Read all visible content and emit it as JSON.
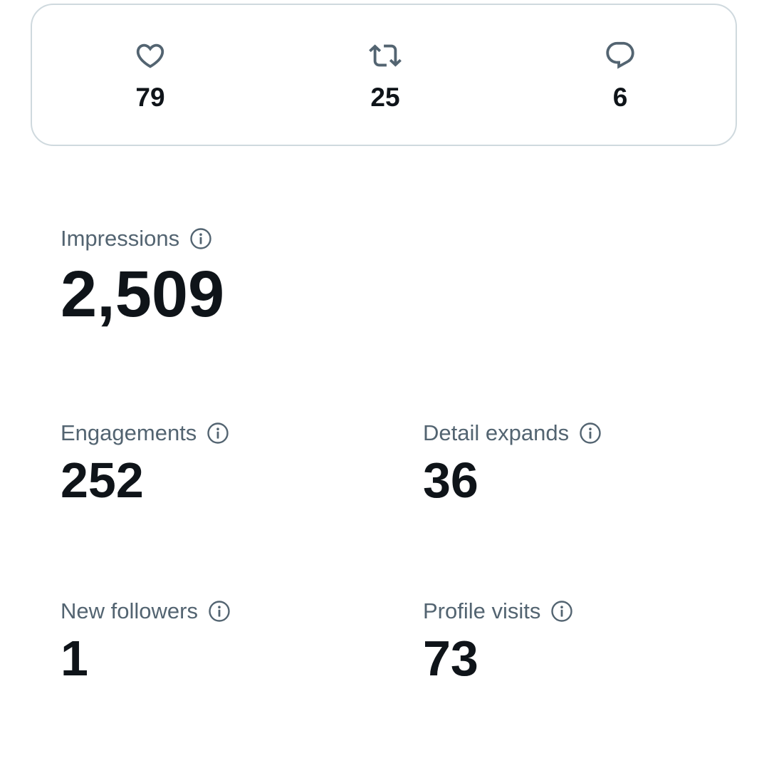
{
  "engagement": {
    "likes": {
      "icon": "heart-icon",
      "count": "79"
    },
    "reposts": {
      "icon": "repost-icon",
      "count": "25"
    },
    "replies": {
      "icon": "reply-icon",
      "count": "6"
    }
  },
  "metrics": {
    "impressions": {
      "label": "Impressions",
      "value": "2,509"
    },
    "engagements": {
      "label": "Engagements",
      "value": "252"
    },
    "detail_expands": {
      "label": "Detail expands",
      "value": "36"
    },
    "new_followers": {
      "label": "New followers",
      "value": "1"
    },
    "profile_visits": {
      "label": "Profile visits",
      "value": "73"
    }
  },
  "colors": {
    "text_primary": "#0f1419",
    "text_secondary": "#536471",
    "border": "#cfd9de",
    "background": "#ffffff"
  }
}
